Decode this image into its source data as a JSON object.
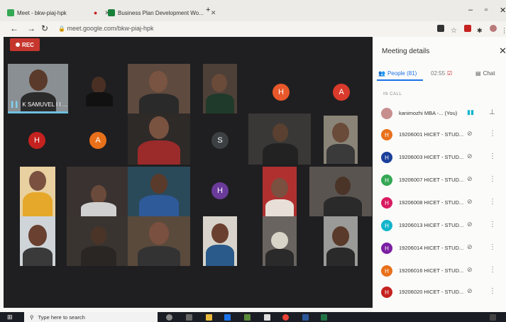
{
  "browser": {
    "tabs": [
      {
        "title": "Meet - bkw-piaj-hpk",
        "fav_color": "#34a853"
      },
      {
        "title": "Business Plan Development Wo...",
        "fav_color": "#188038"
      }
    ],
    "new_tab": "+",
    "url": "meet.google.com/bkw-piaj-hpk"
  },
  "meeting": {
    "rec_label": "REC",
    "spotlight_name": "K SAMUVEL I I ...",
    "avatars": [
      {
        "letter": "H",
        "color": "#e8582a"
      },
      {
        "letter": "A",
        "color": "#d93a2b"
      },
      {
        "letter": "H",
        "color": "#c5221f"
      },
      {
        "letter": "A",
        "color": "#e8701a"
      },
      {
        "letter": "S",
        "color": "#3c4043"
      },
      {
        "letter": "H",
        "color": "#6a3b9a"
      }
    ]
  },
  "panel": {
    "title": "Meeting details",
    "tabs": [
      {
        "label": "People (81)"
      },
      {
        "label": "02:55"
      },
      {
        "label": "Chat"
      }
    ],
    "section": "IN CALL",
    "participants": [
      {
        "initial": "",
        "name": "kanimozhi MBA -... (You)",
        "color": "#c78e8e"
      },
      {
        "initial": "H",
        "name": "19206001 HICET - STUD...",
        "color": "#e8701a"
      },
      {
        "initial": "H",
        "name": "19206003 HICET - STUD...",
        "color": "#1a3f9a"
      },
      {
        "initial": "H",
        "name": "19206007 HICET - STUD...",
        "color": "#34a853"
      },
      {
        "initial": "H",
        "name": "19206008 HICET - STUD...",
        "color": "#d81b60"
      },
      {
        "initial": "H",
        "name": "19206013 HICET - STUD...",
        "color": "#12b5cb"
      },
      {
        "initial": "H",
        "name": "19206014 HICET - STUD...",
        "color": "#7b1fa2"
      },
      {
        "initial": "H",
        "name": "19206016 HICET - STUD...",
        "color": "#e8701a"
      },
      {
        "initial": "H",
        "name": "19206020 HICET - STUD...",
        "color": "#c5221f"
      }
    ]
  },
  "taskbar": {
    "search_placeholder": "Type here to search"
  }
}
